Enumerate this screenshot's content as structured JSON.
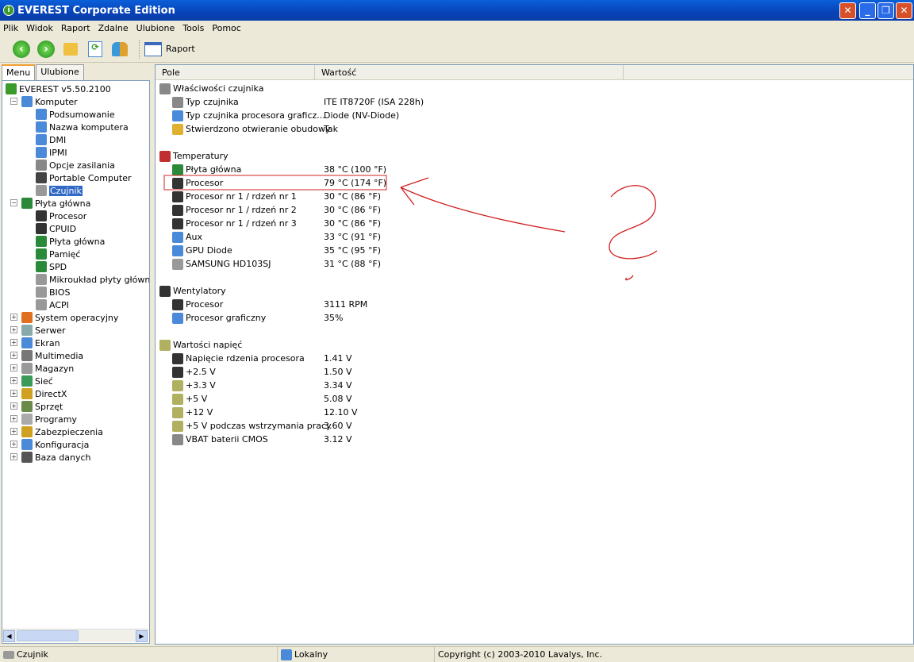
{
  "window": {
    "title": "EVEREST Corporate Edition",
    "min": "_",
    "max": "❐",
    "close": "✕"
  },
  "menu": [
    "Plik",
    "Widok",
    "Raport",
    "Zdalne",
    "Ulubione",
    "Tools",
    "Pomoc"
  ],
  "toolbar": {
    "report_label": "Raport"
  },
  "tabs": [
    "Menu",
    "Ulubione"
  ],
  "tree": [
    {
      "label": "EVEREST v5.50.2100",
      "level": 0,
      "icon": "#3a9a2a"
    },
    {
      "label": "Komputer",
      "level": 1,
      "exp": "-",
      "icon": "#4a8ad8"
    },
    {
      "label": "Podsumowanie",
      "level": 2,
      "icon": "#4a8ad8"
    },
    {
      "label": "Nazwa komputera",
      "level": 2,
      "icon": "#4a8ad8"
    },
    {
      "label": "DMI",
      "level": 2,
      "icon": "#4a8ad8"
    },
    {
      "label": "IPMI",
      "level": 2,
      "icon": "#4a8ad8"
    },
    {
      "label": "Opcje zasilania",
      "level": 2,
      "icon": "#888"
    },
    {
      "label": "Portable Computer",
      "level": 2,
      "icon": "#444"
    },
    {
      "label": "Czujnik",
      "level": 2,
      "icon": "#999",
      "selected": true
    },
    {
      "label": "Płyta główna",
      "level": 1,
      "exp": "-",
      "icon": "#2a8a3a"
    },
    {
      "label": "Procesor",
      "level": 2,
      "icon": "#333"
    },
    {
      "label": "CPUID",
      "level": 2,
      "icon": "#333"
    },
    {
      "label": "Płyta główna",
      "level": 2,
      "icon": "#2a8a3a"
    },
    {
      "label": "Pamięć",
      "level": 2,
      "icon": "#2a8a3a"
    },
    {
      "label": "SPD",
      "level": 2,
      "icon": "#2a8a3a"
    },
    {
      "label": "Mikroukład płyty głównej",
      "level": 2,
      "icon": "#999"
    },
    {
      "label": "BIOS",
      "level": 2,
      "icon": "#999"
    },
    {
      "label": "ACPI",
      "level": 2,
      "icon": "#999"
    },
    {
      "label": "System operacyjny",
      "level": 1,
      "exp": "+",
      "icon": "#e07020"
    },
    {
      "label": "Serwer",
      "level": 1,
      "exp": "+",
      "icon": "#8aa"
    },
    {
      "label": "Ekran",
      "level": 1,
      "exp": "+",
      "icon": "#4a8ad8"
    },
    {
      "label": "Multimedia",
      "level": 1,
      "exp": "+",
      "icon": "#777"
    },
    {
      "label": "Magazyn",
      "level": 1,
      "exp": "+",
      "icon": "#999"
    },
    {
      "label": "Sieć",
      "level": 1,
      "exp": "+",
      "icon": "#3a9a5a"
    },
    {
      "label": "DirectX",
      "level": 1,
      "exp": "+",
      "icon": "#d0a020"
    },
    {
      "label": "Sprzęt",
      "level": 1,
      "exp": "+",
      "icon": "#6a8a4a"
    },
    {
      "label": "Programy",
      "level": 1,
      "exp": "+",
      "icon": "#aaa"
    },
    {
      "label": "Zabezpieczenia",
      "level": 1,
      "exp": "+",
      "icon": "#d0a020"
    },
    {
      "label": "Konfiguracja",
      "level": 1,
      "exp": "+",
      "icon": "#4a8ad8"
    },
    {
      "label": "Baza danych",
      "level": 1,
      "exp": "+",
      "icon": "#555"
    }
  ],
  "columns": [
    "Pole",
    "Wartość"
  ],
  "rows": [
    {
      "group": true,
      "field": "Właściwości czujnika",
      "icon": "#888"
    },
    {
      "field": "Typ czujnika",
      "value": "ITE IT8720F  (ISA 228h)",
      "icon": "#888"
    },
    {
      "field": "Typ czujnika procesora graficz...",
      "value": "Diode  (NV-Diode)",
      "icon": "#4a8ad8"
    },
    {
      "field": "Stwierdzono otwieranie obudowy",
      "value": "Tak",
      "icon": "#e0b030"
    },
    {
      "blank": true
    },
    {
      "group": true,
      "field": "Temperatury",
      "icon": "#c03030"
    },
    {
      "field": "Płyta główna",
      "value": "38 °C  (100 °F)",
      "icon": "#2a8a3a"
    },
    {
      "field": "Procesor",
      "value": "79 °C  (174 °F)",
      "icon": "#333"
    },
    {
      "field": "Procesor nr 1 / rdzeń nr 1",
      "value": "30 °C  (86 °F)",
      "icon": "#333"
    },
    {
      "field": "Procesor nr 1 / rdzeń nr 2",
      "value": "30 °C  (86 °F)",
      "icon": "#333"
    },
    {
      "field": "Procesor nr 1 / rdzeń nr 3",
      "value": "30 °C  (86 °F)",
      "icon": "#333"
    },
    {
      "field": "Aux",
      "value": "33 °C  (91 °F)",
      "icon": "#4a8ad8"
    },
    {
      "field": "GPU Diode",
      "value": "35 °C  (95 °F)",
      "icon": "#4a8ad8"
    },
    {
      "field": "SAMSUNG HD103SJ",
      "value": "31 °C  (88 °F)",
      "icon": "#999"
    },
    {
      "blank": true
    },
    {
      "group": true,
      "field": "Wentylatory",
      "icon": "#333"
    },
    {
      "field": "Procesor",
      "value": "3111 RPM",
      "icon": "#333"
    },
    {
      "field": "Procesor graficzny",
      "value": "35%",
      "icon": "#4a8ad8"
    },
    {
      "blank": true
    },
    {
      "group": true,
      "field": "Wartości napięć",
      "icon": "#b0b060"
    },
    {
      "field": "Napięcie rdzenia procesora",
      "value": "1.41 V",
      "icon": "#333"
    },
    {
      "field": "+2.5 V",
      "value": "1.50 V",
      "icon": "#333"
    },
    {
      "field": "+3.3 V",
      "value": "3.34 V",
      "icon": "#b0b060"
    },
    {
      "field": "+5 V",
      "value": "5.08 V",
      "icon": "#b0b060"
    },
    {
      "field": "+12 V",
      "value": "12.10 V",
      "icon": "#b0b060"
    },
    {
      "field": "+5 V podczas wstrzymania pracy",
      "value": "3.60 V",
      "icon": "#b0b060"
    },
    {
      "field": "VBAT baterii CMOS",
      "value": "3.12 V",
      "icon": "#888"
    }
  ],
  "status": {
    "node": "Czujnik",
    "mode": "Lokalny",
    "copyright": "Copyright (c) 2003-2010 Lavalys, Inc."
  },
  "annotation_color": "#d02020"
}
